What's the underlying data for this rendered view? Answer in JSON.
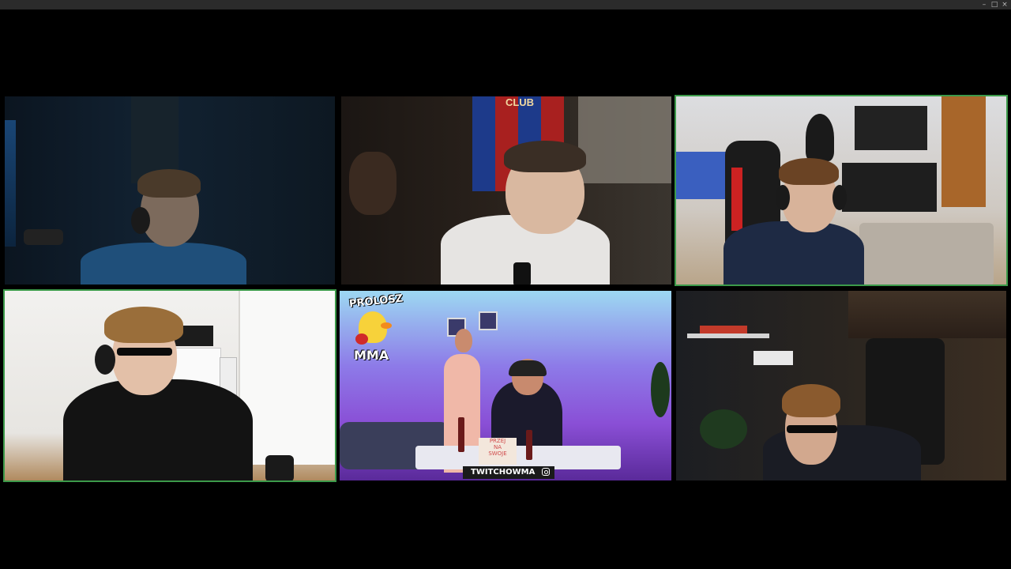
{
  "window": {
    "controls": {
      "minimize": "–",
      "maximize": "□",
      "close": "×"
    }
  },
  "grid": {
    "tiles": [
      {
        "id": "t1",
        "active": false
      },
      {
        "id": "t2",
        "active": false
      },
      {
        "id": "t3",
        "active": true
      },
      {
        "id": "t4",
        "active": true
      },
      {
        "id": "t5",
        "active": false,
        "logo_top": "PROLOSZ",
        "logo_bottom": "MMA",
        "banner": "TWITCHOWMA",
        "sign": "PRZEJ\nNA\nSWOJE"
      },
      {
        "id": "t6",
        "active": false
      }
    ],
    "tile2_flag_text": "CLUB"
  },
  "colors": {
    "active_border": "#3c9a4a",
    "background": "#000000",
    "titlebar": "#2b2b2b"
  }
}
